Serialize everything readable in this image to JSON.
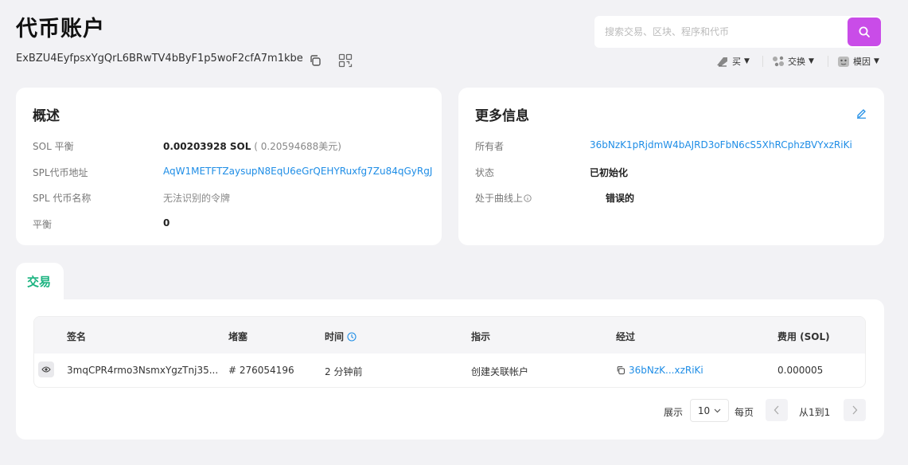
{
  "page": {
    "title": "代币账户",
    "address": "ExBZU4EyfpsxYgQrL6BRwTV4bByF1p5woF2cfA7m1kbe"
  },
  "search": {
    "placeholder": "搜索交易、区块、程序和代币"
  },
  "topnav": {
    "buy": "买",
    "swap": "交换",
    "mode": "模因"
  },
  "overview": {
    "title": "概述",
    "rows": [
      {
        "label": "SOL 平衡",
        "value": "0.00203928 SOL",
        "extra": "( 0.20594688美元)"
      },
      {
        "label": "SPL代币地址",
        "value": "AqW1METFTZaysupN8EqU6eGrQEHYRuxfg7Zu84qGyRgJ"
      },
      {
        "label": "SPL 代币名称",
        "value": "无法识别的令牌"
      },
      {
        "label": "平衡",
        "value": "0"
      }
    ]
  },
  "more_info": {
    "title": "更多信息",
    "rows": [
      {
        "label": "所有者",
        "value": "36bNzK1pRjdmW4bAJRD3oFbN6cS5XhRCphzBVYxzRiKi"
      },
      {
        "label": "状态",
        "value": "已初始化"
      },
      {
        "label": "处于曲线上",
        "value": "错误的"
      }
    ]
  },
  "transactions": {
    "tab": "交易",
    "headers": [
      "签名",
      "堵塞",
      "时间",
      "指示",
      "经过",
      "费用 (SOL)"
    ],
    "rows": [
      {
        "signature": "3mqCPR4rmo3NsmxYgzTnj35...",
        "block": "# 276054196",
        "time": "2 分钟前",
        "instruction": "创建关联帐户",
        "by": "36bNzK...xzRiKi",
        "fee": "0.000005"
      }
    ]
  },
  "pagination": {
    "show": "展示",
    "per_page_value": "10",
    "per_page": "每页",
    "range": "从1到1"
  },
  "colors": {
    "accent": "#c94ce8",
    "link": "#1e8de6",
    "tab_green": "#1bb380"
  }
}
